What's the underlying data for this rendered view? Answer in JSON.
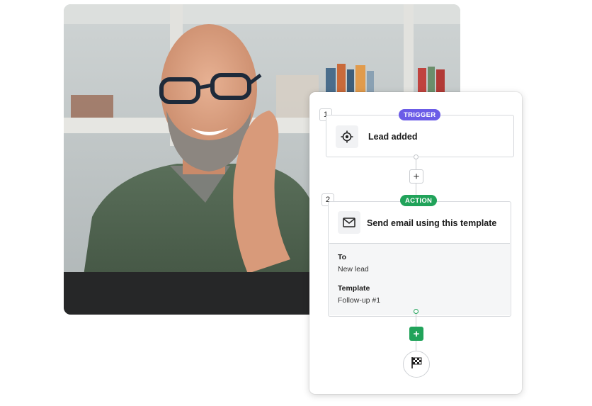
{
  "workflow": {
    "step1": {
      "number": "1",
      "badge": "TRIGGER",
      "title": "Lead added",
      "icon": "target-icon"
    },
    "step2": {
      "number": "2",
      "badge": "ACTION",
      "title": "Send email using this template",
      "icon": "envelope-icon",
      "fields": [
        {
          "label": "To",
          "value": "New lead"
        },
        {
          "label": "Template",
          "value": "Follow-up #1"
        }
      ]
    },
    "add_step_label": "+",
    "finish_icon": "checkered-flag-icon"
  },
  "colors": {
    "trigger": "#6b5ce7",
    "action": "#21a35a"
  }
}
